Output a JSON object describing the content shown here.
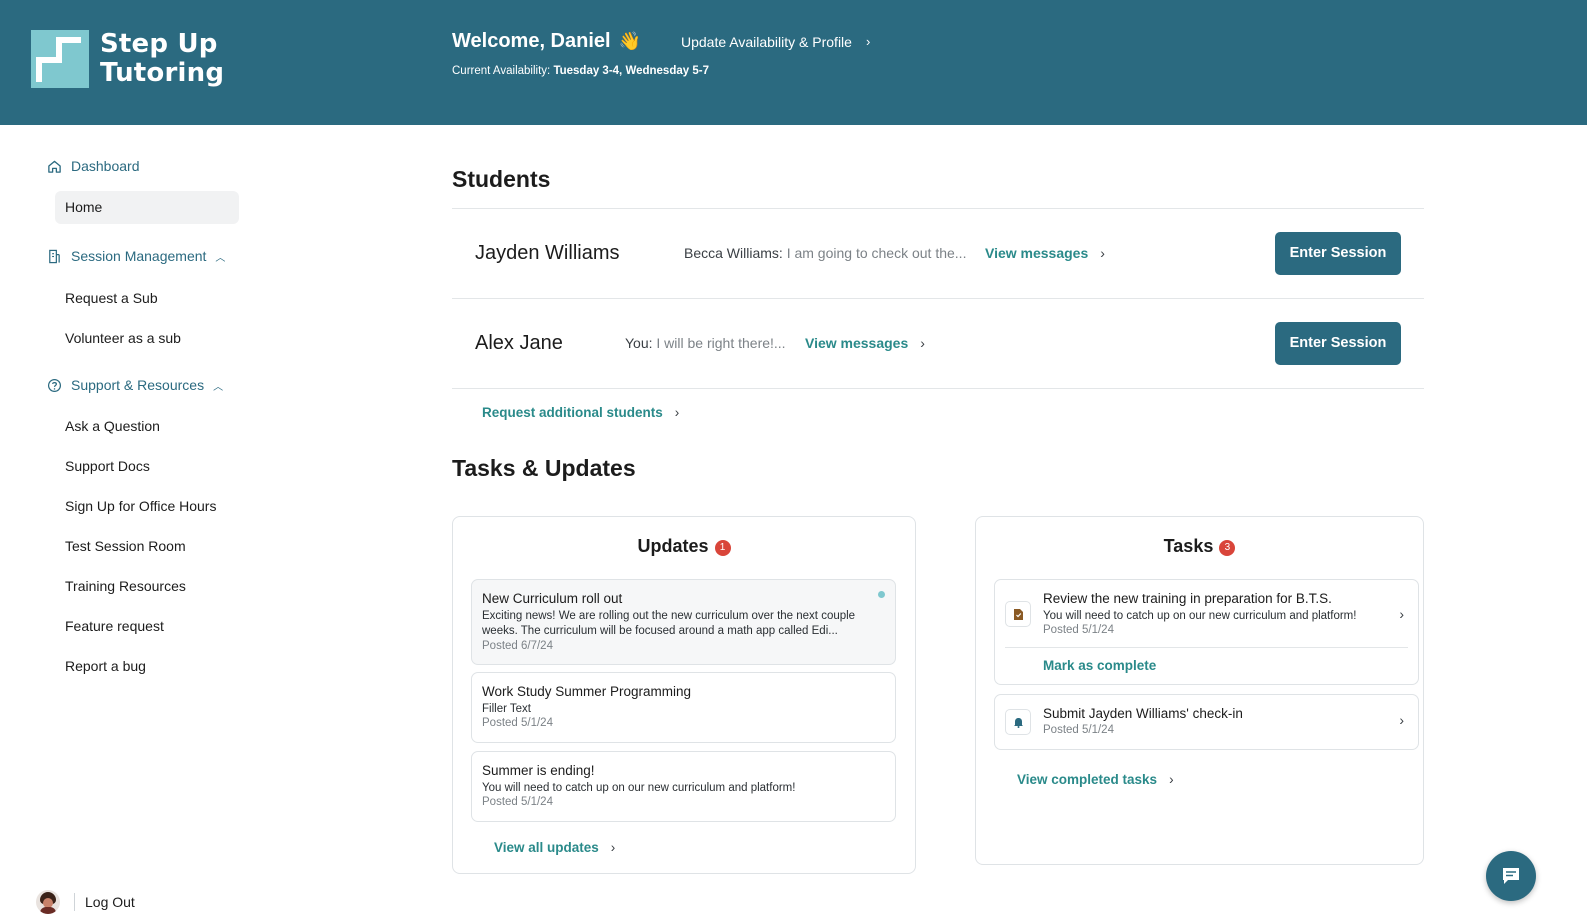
{
  "app": {
    "logo_line1": "Step Up",
    "logo_line2": "Tutoring"
  },
  "header": {
    "welcome": "Welcome, Daniel",
    "wave_emoji": "👋",
    "update_link": "Update Availability & Profile",
    "availability_label": "Current Availability:",
    "availability_value": "Tuesday 3-4, Wednesday 5-7"
  },
  "sidebar": {
    "dashboard": "Dashboard",
    "home": "Home",
    "session_management": "Session Management",
    "session_items": [
      "Request a Sub",
      "Volunteer as a sub"
    ],
    "support_resources": "Support & Resources",
    "support_items": [
      "Ask a Question",
      "Support Docs",
      "Sign Up for Office Hours",
      "Test Session Room",
      "Training Resources",
      "Feature request",
      "Report a bug"
    ],
    "logout": "Log Out"
  },
  "students": {
    "title": "Students",
    "rows": [
      {
        "name": "Jayden Williams",
        "sender": "Becca Williams:",
        "preview": "I am going to check out the...",
        "view_label": "View messages",
        "enter_label": "Enter Session"
      },
      {
        "name": "Alex Jane",
        "sender": "You:",
        "preview": "I will be right there!...",
        "view_label": "View messages",
        "enter_label": "Enter Session"
      }
    ],
    "request_link": "Request additional students"
  },
  "tasks_updates": {
    "title": "Tasks & Updates",
    "updates": {
      "title": "Updates",
      "count": "1",
      "items": [
        {
          "title": "New Curriculum roll out",
          "body": "Exciting news! We are rolling out the new curriculum over the next couple weeks. The curriculum will be focused around a math app called Edi...",
          "date": "Posted 6/7/24",
          "unread": true
        },
        {
          "title": "Work Study Summer Programming",
          "body": "Filler Text",
          "date": "Posted 5/1/24",
          "unread": false
        },
        {
          "title": "Summer is ending!",
          "body": "You will need to catch up on our new curriculum and platform!",
          "date": "Posted 5/1/24",
          "unread": false
        }
      ],
      "view_all": "View all updates"
    },
    "tasks": {
      "title": "Tasks",
      "count": "3",
      "items": [
        {
          "icon": "document-icon",
          "title": "Review the new training in preparation for B.T.S.",
          "body": "You will need to catch up on our new curriculum and platform!",
          "date": "Posted 5/1/24",
          "action": "Mark as complete"
        },
        {
          "icon": "bell-icon",
          "title": "Submit Jayden Williams' check-in",
          "date": "Posted 5/1/24"
        }
      ],
      "view_completed": "View completed tasks"
    }
  },
  "colors": {
    "brand": "#2b6a80",
    "accent_link": "#2a8a8a",
    "logo_light": "#7fc8cf",
    "badge": "#d9453a"
  }
}
